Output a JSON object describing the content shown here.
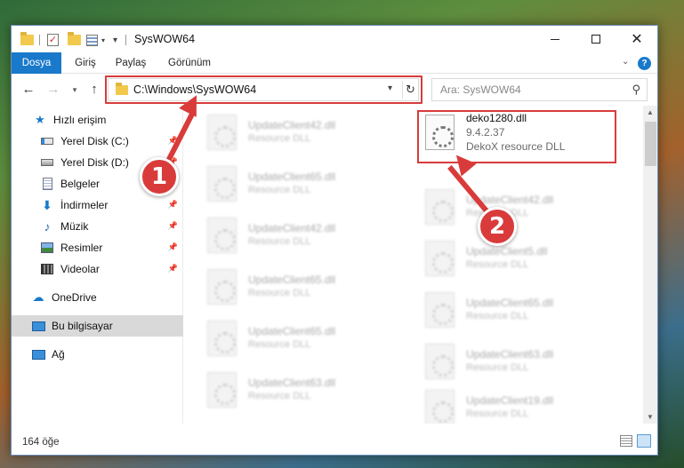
{
  "window": {
    "title": "SysWOW64"
  },
  "ribbon": {
    "tabs": [
      "Dosya",
      "Giriş",
      "Paylaş",
      "Görünüm"
    ],
    "help_label": "?",
    "accent_color": "#1979ca"
  },
  "address": {
    "path": "C:\\Windows\\SysWOW64",
    "refresh_glyph": "↻",
    "dropdown_glyph": "▾"
  },
  "search": {
    "placeholder": "Ara: SysWOW64",
    "icon": "search-icon"
  },
  "navigation": {
    "back_glyph": "←",
    "forward_glyph": "→",
    "recent_glyph": "▾",
    "up_glyph": "↑"
  },
  "sidebar": {
    "items": [
      {
        "label": "Hızlı erişim",
        "icon": "star-icon",
        "pinned": false
      },
      {
        "label": "Yerel Disk (C:)",
        "icon": "windows-drive-icon",
        "pinned": true
      },
      {
        "label": "Yerel Disk (D:)",
        "icon": "drive-icon",
        "pinned": true
      },
      {
        "label": "Belgeler",
        "icon": "documents-icon",
        "pinned": true
      },
      {
        "label": "İndirmeler",
        "icon": "downloads-icon",
        "pinned": true
      },
      {
        "label": "Müzik",
        "icon": "music-icon",
        "pinned": true
      },
      {
        "label": "Resimler",
        "icon": "pictures-icon",
        "pinned": true
      },
      {
        "label": "Videolar",
        "icon": "videos-icon",
        "pinned": true
      },
      {
        "label": "OneDrive",
        "icon": "cloud-icon",
        "pinned": false
      },
      {
        "label": "Bu bilgisayar",
        "icon": "computer-icon",
        "pinned": false,
        "selected": true
      },
      {
        "label": "Ağ",
        "icon": "network-icon",
        "pinned": false
      }
    ],
    "pin_glyph": "📌"
  },
  "files": {
    "featured": {
      "name": "deko1280.dll",
      "version": "9.4.2.37",
      "description": "DekoX resource DLL"
    },
    "left_column": [
      {
        "name": "UpdateClient42.dll",
        "description": "Resource DLL"
      },
      {
        "name": "UpdateClient65.dll",
        "description": "Resource DLL"
      },
      {
        "name": "UpdateClient42.dll",
        "description": "Resource DLL"
      },
      {
        "name": "UpdateClient65.dll",
        "description": "Resource DLL"
      },
      {
        "name": "UpdateClient65.dll",
        "description": "Resource DLL"
      },
      {
        "name": "UpdateClient63.dll",
        "description": "Resource DLL"
      }
    ],
    "right_column": [
      {
        "name": "UpdateClient42.dll",
        "description": "Resource DLL"
      },
      {
        "name": "UpdateClient5.dll",
        "description": "Resource DLL"
      },
      {
        "name": "UpdateClient65.dll",
        "description": "Resource DLL"
      },
      {
        "name": "UpdateClient63.dll",
        "description": "Resource DLL"
      },
      {
        "name": "UpdateClient19.dll",
        "description": "Resource DLL"
      }
    ]
  },
  "status": {
    "item_count": "164 öğe"
  },
  "annotations": {
    "step1": "1",
    "step2": "2",
    "highlight_color": "#d93b3b"
  },
  "window_controls": {
    "minimize": "—",
    "close": "✕"
  }
}
